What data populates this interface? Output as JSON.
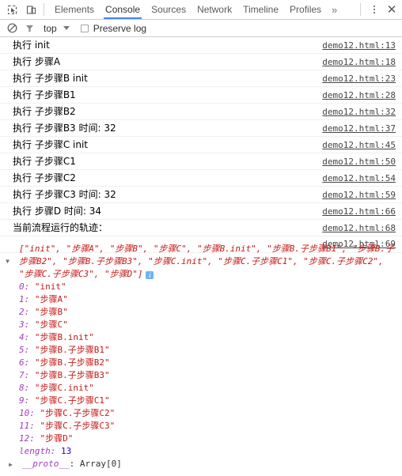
{
  "toolbar": {
    "inspect_icon": "inspect-cursor-icon",
    "device_icon": "device-toolbar-icon",
    "tabs": [
      {
        "label": "Elements",
        "active": false
      },
      {
        "label": "Console",
        "active": true
      },
      {
        "label": "Sources",
        "active": false
      },
      {
        "label": "Network",
        "active": false
      },
      {
        "label": "Timeline",
        "active": false
      },
      {
        "label": "Profiles",
        "active": false
      }
    ],
    "more_tabs_label": "»",
    "menu_icon": "vertical-dots-icon",
    "close_label": "✕",
    "active_tab_color": "#4285f4"
  },
  "filterbar": {
    "clear_icon": "clear-console-icon",
    "filter_icon": "filter-funnel-icon",
    "context_label": "top",
    "preserve_log_label": "Preserve log",
    "preserve_log_checked": false
  },
  "console": {
    "rows": [
      {
        "message": "执行 init",
        "source": "demo12.html:13"
      },
      {
        "message": "执行 步骤A",
        "source": "demo12.html:18"
      },
      {
        "message": "执行 子步骤B init",
        "source": "demo12.html:23"
      },
      {
        "message": "执行 子步骤B1",
        "source": "demo12.html:28"
      },
      {
        "message": "执行 子步骤B2",
        "source": "demo12.html:32"
      },
      {
        "message": "执行 子步骤B3 时间: 32",
        "source": "demo12.html:37"
      },
      {
        "message": "执行 子步骤C init",
        "source": "demo12.html:45"
      },
      {
        "message": "执行 子步骤C1",
        "source": "demo12.html:50"
      },
      {
        "message": "执行 子步骤C2",
        "source": "demo12.html:54"
      },
      {
        "message": "执行 子步骤C3 时间: 32",
        "source": "demo12.html:59"
      },
      {
        "message": "执行 步骤D 时间: 34",
        "source": "demo12.html:66"
      },
      {
        "message": "当前流程运行的轨迹：",
        "source": "demo12.html:68"
      },
      {
        "message": "",
        "source": "demo12.html:69"
      }
    ]
  },
  "array_object": {
    "preview": "[\"init\", \"步骤A\", \"步骤B\", \"步骤C\", \"步骤B.init\", \"步骤B.子步骤B1\", \"步骤B.子步骤B2\", \"步骤B.子步骤B3\", \"步骤C.init\", \"步骤C.子步骤C1\", \"步骤C.子步骤C2\", \"步骤C.子步骤C3\", \"步骤D\"]",
    "info_badge": "i",
    "expanded": true,
    "items": [
      {
        "index": "0",
        "value": "\"init\""
      },
      {
        "index": "1",
        "value": "\"步骤A\""
      },
      {
        "index": "2",
        "value": "\"步骤B\""
      },
      {
        "index": "3",
        "value": "\"步骤C\""
      },
      {
        "index": "4",
        "value": "\"步骤B.init\""
      },
      {
        "index": "5",
        "value": "\"步骤B.子步骤B1\""
      },
      {
        "index": "6",
        "value": "\"步骤B.子步骤B2\""
      },
      {
        "index": "7",
        "value": "\"步骤B.子步骤B3\""
      },
      {
        "index": "8",
        "value": "\"步骤C.init\""
      },
      {
        "index": "9",
        "value": "\"步骤C.子步骤C1\""
      },
      {
        "index": "10",
        "value": "\"步骤C.子步骤C2\""
      },
      {
        "index": "11",
        "value": "\"步骤C.子步骤C3\""
      },
      {
        "index": "12",
        "value": "\"步骤D\""
      }
    ],
    "length_key": "length",
    "length_value": "13",
    "proto_key": "__proto__",
    "proto_value": "Array[0]"
  }
}
